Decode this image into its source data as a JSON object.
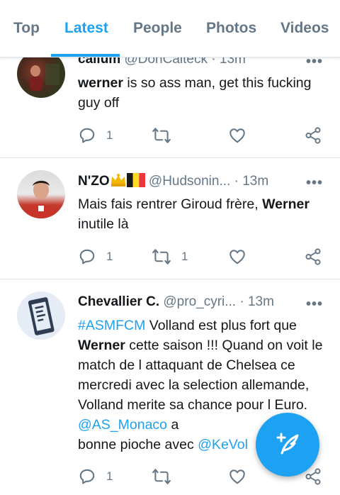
{
  "tabs": [
    {
      "label": "Top",
      "active": false
    },
    {
      "label": "Latest",
      "active": true
    },
    {
      "label": "People",
      "active": false
    },
    {
      "label": "Photos",
      "active": false
    },
    {
      "label": "Videos",
      "active": false
    }
  ],
  "tweets": [
    {
      "name": "callum",
      "handle": "@DonCalteck",
      "time": "13m",
      "text_bold_1": "werner",
      "text_1": " is so ass man, get this fucking guy off",
      "replies": "1",
      "retweets": "",
      "likes": ""
    },
    {
      "name": "N'ZO",
      "handle": "@Hudsonin...",
      "time": "13m",
      "text_1": "Mais fais rentrer Giroud frère, ",
      "text_bold_1": "Werner",
      "text_2": " inutile là",
      "replies": "1",
      "retweets": "1",
      "likes": ""
    },
    {
      "name": "Chevallier C.",
      "handle": "@pro_cyri...",
      "time": "13m",
      "hashtag": "#ASMFCM",
      "text_1": " Volland est plus fort que ",
      "text_bold_1": "Werner",
      "text_2": " cette saison !!! Quand on voit le match de l attaquant de Chelsea ce mercredi avec la selection allemande, Volland merite sa chance pour l Euro. ",
      "mention_1": "@AS_Monaco",
      "text_3": " a",
      "text_4": "bonne pioche avec ",
      "mention_2": "@KeVol",
      "replies": "1",
      "retweets": "",
      "likes": ""
    }
  ],
  "icons": {
    "reply": "reply-icon",
    "retweet": "retweet-icon",
    "like": "heart-icon",
    "share": "share-icon",
    "more": "more-icon",
    "compose": "compose-tweet-icon"
  },
  "colors": {
    "accent": "#1da1f2",
    "text": "#14171a",
    "muted": "#657786",
    "border": "#e1e8ed"
  },
  "more_glyph": "•••",
  "dot": "·"
}
